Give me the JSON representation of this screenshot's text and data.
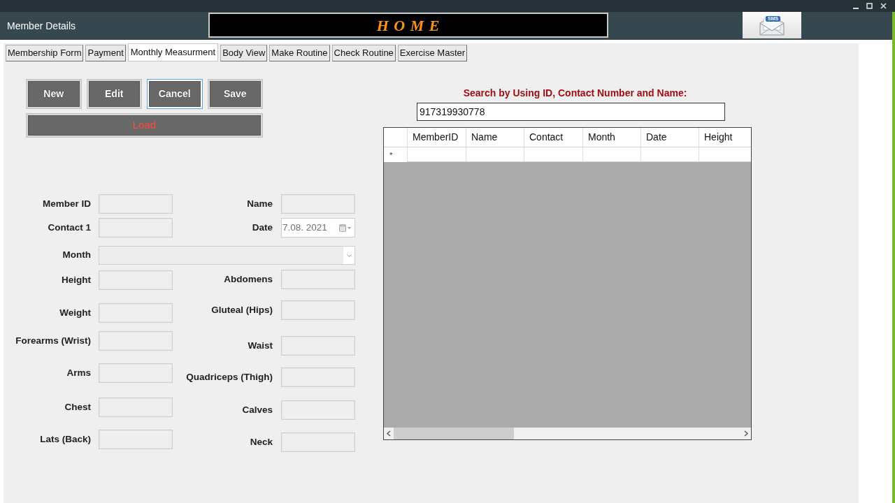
{
  "window": {
    "title": "Member Details",
    "banner": "H O M E",
    "sms_badge": "SMS"
  },
  "tabs": [
    {
      "label": "Membership Form",
      "selected": false
    },
    {
      "label": "Payment",
      "selected": false
    },
    {
      "label": "Monthly Measurment",
      "selected": true
    },
    {
      "label": "Body View",
      "selected": false
    },
    {
      "label": "Make Routine",
      "selected": false
    },
    {
      "label": "Check Routine",
      "selected": false
    },
    {
      "label": "Exercise Master",
      "selected": false
    }
  ],
  "actions": [
    {
      "label": "New",
      "focused": false
    },
    {
      "label": "Edit",
      "focused": false
    },
    {
      "label": "Cancel",
      "focused": true
    },
    {
      "label": "Save",
      "focused": false
    }
  ],
  "load_action": {
    "label": "Load"
  },
  "form": {
    "rows": [
      [
        {
          "label": "Member ID",
          "kind": "text",
          "disabled": true
        },
        {
          "label": "Name",
          "kind": "text",
          "disabled": true
        }
      ],
      [
        {
          "label": "Contact 1",
          "kind": "text",
          "disabled": true
        },
        {
          "label": "Date",
          "kind": "date",
          "disabled": false,
          "value": "7.08. 2021"
        }
      ]
    ],
    "month": {
      "label": "Month",
      "disabled": true
    },
    "left_column": [
      {
        "label": "Height",
        "disabled": true
      },
      {
        "label": "Weight",
        "disabled": true
      },
      {
        "label": "Forearms (Wrist)",
        "disabled": true
      },
      {
        "label": "Arms",
        "disabled": true
      },
      {
        "label": "Chest",
        "disabled": true
      },
      {
        "label": "Lats (Back)",
        "disabled": true
      }
    ],
    "right_column": [
      {
        "label": "Abdomens",
        "disabled": true
      },
      {
        "label": "Gluteal (Hips)",
        "disabled": true
      },
      {
        "label": "Waist",
        "disabled": true
      },
      {
        "label": "Quadriceps (Thigh)",
        "disabled": true
      },
      {
        "label": "Calves",
        "disabled": true
      },
      {
        "label": "Neck",
        "disabled": true
      }
    ]
  },
  "search": {
    "label": "Search by Using ID, Contact Number and Name:",
    "value": "917319930778"
  },
  "table": {
    "columns": [
      "MemberID",
      "Name",
      "Contact",
      "Month",
      "Date",
      "Height"
    ],
    "new_row_marker": "*"
  }
}
